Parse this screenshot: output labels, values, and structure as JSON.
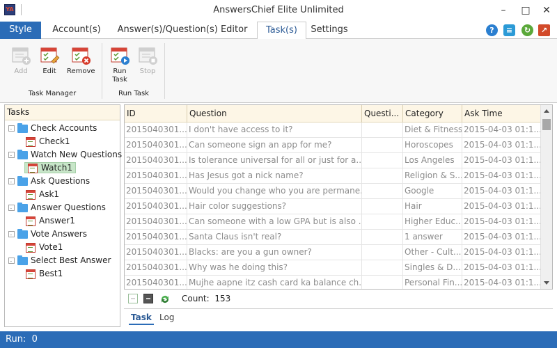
{
  "window": {
    "title": "AnswersChief Elite Unlimited",
    "app_icon_text": "YA"
  },
  "ribbon_tabs": [
    {
      "label": "Style"
    },
    {
      "label": "Account(s)"
    },
    {
      "label": "Answer(s)/Question(s) Editor"
    },
    {
      "label": "Task(s)"
    },
    {
      "label": "Settings"
    }
  ],
  "ribbon": {
    "groups": [
      {
        "label": "Task Manager",
        "buttons": [
          {
            "label": "Add",
            "enabled": false
          },
          {
            "label": "Edit",
            "enabled": true
          },
          {
            "label": "Remove",
            "enabled": true
          }
        ]
      },
      {
        "label": "Run Task",
        "buttons": [
          {
            "label": "Run Task",
            "enabled": true
          },
          {
            "label": "Stop",
            "enabled": false
          }
        ]
      }
    ]
  },
  "tree": {
    "header": "Tasks",
    "nodes": [
      {
        "label": "Check Accounts",
        "children": [
          "Check1"
        ]
      },
      {
        "label": "Watch New Questions",
        "children": [
          "Watch1"
        ],
        "selected_child": "Watch1"
      },
      {
        "label": "Ask Questions",
        "children": [
          "Ask1"
        ]
      },
      {
        "label": "Answer Questions",
        "children": [
          "Answer1"
        ]
      },
      {
        "label": "Vote Answers",
        "children": [
          "Vote1"
        ]
      },
      {
        "label": "Select Best Answer",
        "children": [
          "Best1"
        ]
      }
    ]
  },
  "grid": {
    "columns": [
      "ID",
      "Question",
      "Questi...",
      "Category",
      "Ask Time"
    ],
    "rows": [
      {
        "id": "2015040301...",
        "question": "I don't have access to it?",
        "q": "",
        "category": "Diet & Fitness",
        "time": "2015-04-03 01:1..."
      },
      {
        "id": "2015040301...",
        "question": "Can someone sign an app for me?",
        "q": "",
        "category": "Horoscopes",
        "time": "2015-04-03 01:1..."
      },
      {
        "id": "2015040301...",
        "question": "Is tolerance universal for all or just for a...",
        "q": "",
        "category": "Los Angeles",
        "time": "2015-04-03 01:1..."
      },
      {
        "id": "2015040301...",
        "question": "Has Jesus got a nick name?",
        "q": "",
        "category": "Religion & S...",
        "time": "2015-04-03 01:1..."
      },
      {
        "id": "2015040301...",
        "question": "Would you change who you are permane...",
        "q": "",
        "category": "Google",
        "time": "2015-04-03 01:1..."
      },
      {
        "id": "2015040301...",
        "question": "Hair color suggestions?",
        "q": "",
        "category": "Hair",
        "time": "2015-04-03 01:1..."
      },
      {
        "id": "2015040301...",
        "question": "Can someone with a low GPA but is also ...",
        "q": "",
        "category": "Higher Educ...",
        "time": "2015-04-03 01:1..."
      },
      {
        "id": "2015040301...",
        "question": "Santa Claus isn't real?",
        "q": "",
        "category": "1 answer",
        "time": "2015-04-03 01:1..."
      },
      {
        "id": "2015040301...",
        "question": "Blacks: are you a gun owner?",
        "q": "",
        "category": "Other - Cult...",
        "time": "2015-04-03 01:1..."
      },
      {
        "id": "2015040301...",
        "question": "Why was he doing this?",
        "q": "",
        "category": "Singles & D...",
        "time": "2015-04-03 01:1..."
      },
      {
        "id": "2015040301...",
        "question": "Mujhe aapne itz cash card ka balance ch...",
        "q": "",
        "category": "Personal Fin...",
        "time": "2015-04-03 01:1..."
      }
    ]
  },
  "bottom": {
    "count_label": "Count:",
    "count_value": "153",
    "tabs": [
      "Task",
      "Log"
    ]
  },
  "status": {
    "label": "Run:",
    "value": "0"
  }
}
